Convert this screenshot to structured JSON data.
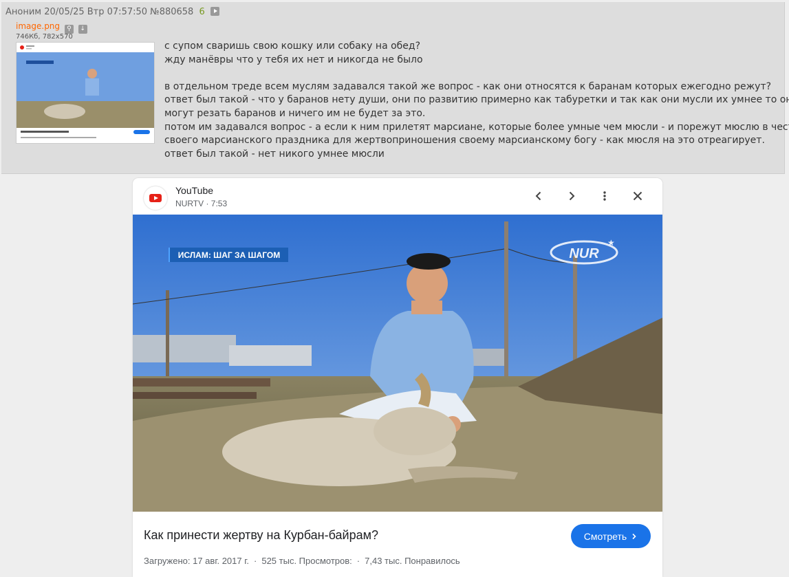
{
  "post": {
    "author": "Аноним",
    "datetime": "20/05/25 Втр 07:57:50",
    "number": "№880658",
    "replies": "6",
    "file": {
      "name": "image.png",
      "meta": "746Кб, 782x570"
    },
    "lines": [
      "с супом сваришь свою кошку или собаку на обед?",
      "жду манёвры что у тебя их нет и никогда не было",
      "",
      "в отдельном треде всем муслям задавался такой же вопрос - как они относятся к баранам которых ежегодно режут?",
      "ответ был такой - что у баранов нету души, они по развитию примерно как табуретки и так как они мусли их умнее то они",
      "могут резать баранов и ничего им не будет за это.",
      "потом им задавался вопрос - а если к ним прилетят марсиане, которые более умные чем мюсли - и порежут мюслю в честь",
      "своего марсианского праздника для жертвоприношения своему марсианскому богу - как мюсля на это отреагирует.",
      "ответ был такой - нет никого умнее мюсли"
    ]
  },
  "card": {
    "app": "YouTube",
    "channel": "NURTV · 7:53",
    "overlay_caption": "ИСЛАМ: ШАГ ЗА ШАГОМ",
    "overlay_logo": "NUR",
    "video_title": "Как принести жертву на Курбан-байрам?",
    "watch_label": "Смотреть",
    "stats": {
      "uploaded": "Загружено: 17 авг. 2017 г.",
      "views": "525 тыс. Просмотров:",
      "likes": "7,43 тыс. Понравилось"
    },
    "icons": [
      "chevron-left-icon",
      "chevron-right-icon",
      "more-vert-icon",
      "close-icon"
    ]
  },
  "colors": {
    "accent": "#1a73e8",
    "reply_count": "#789922",
    "file_link": "#ff6600",
    "yt_red": "#e62117"
  }
}
